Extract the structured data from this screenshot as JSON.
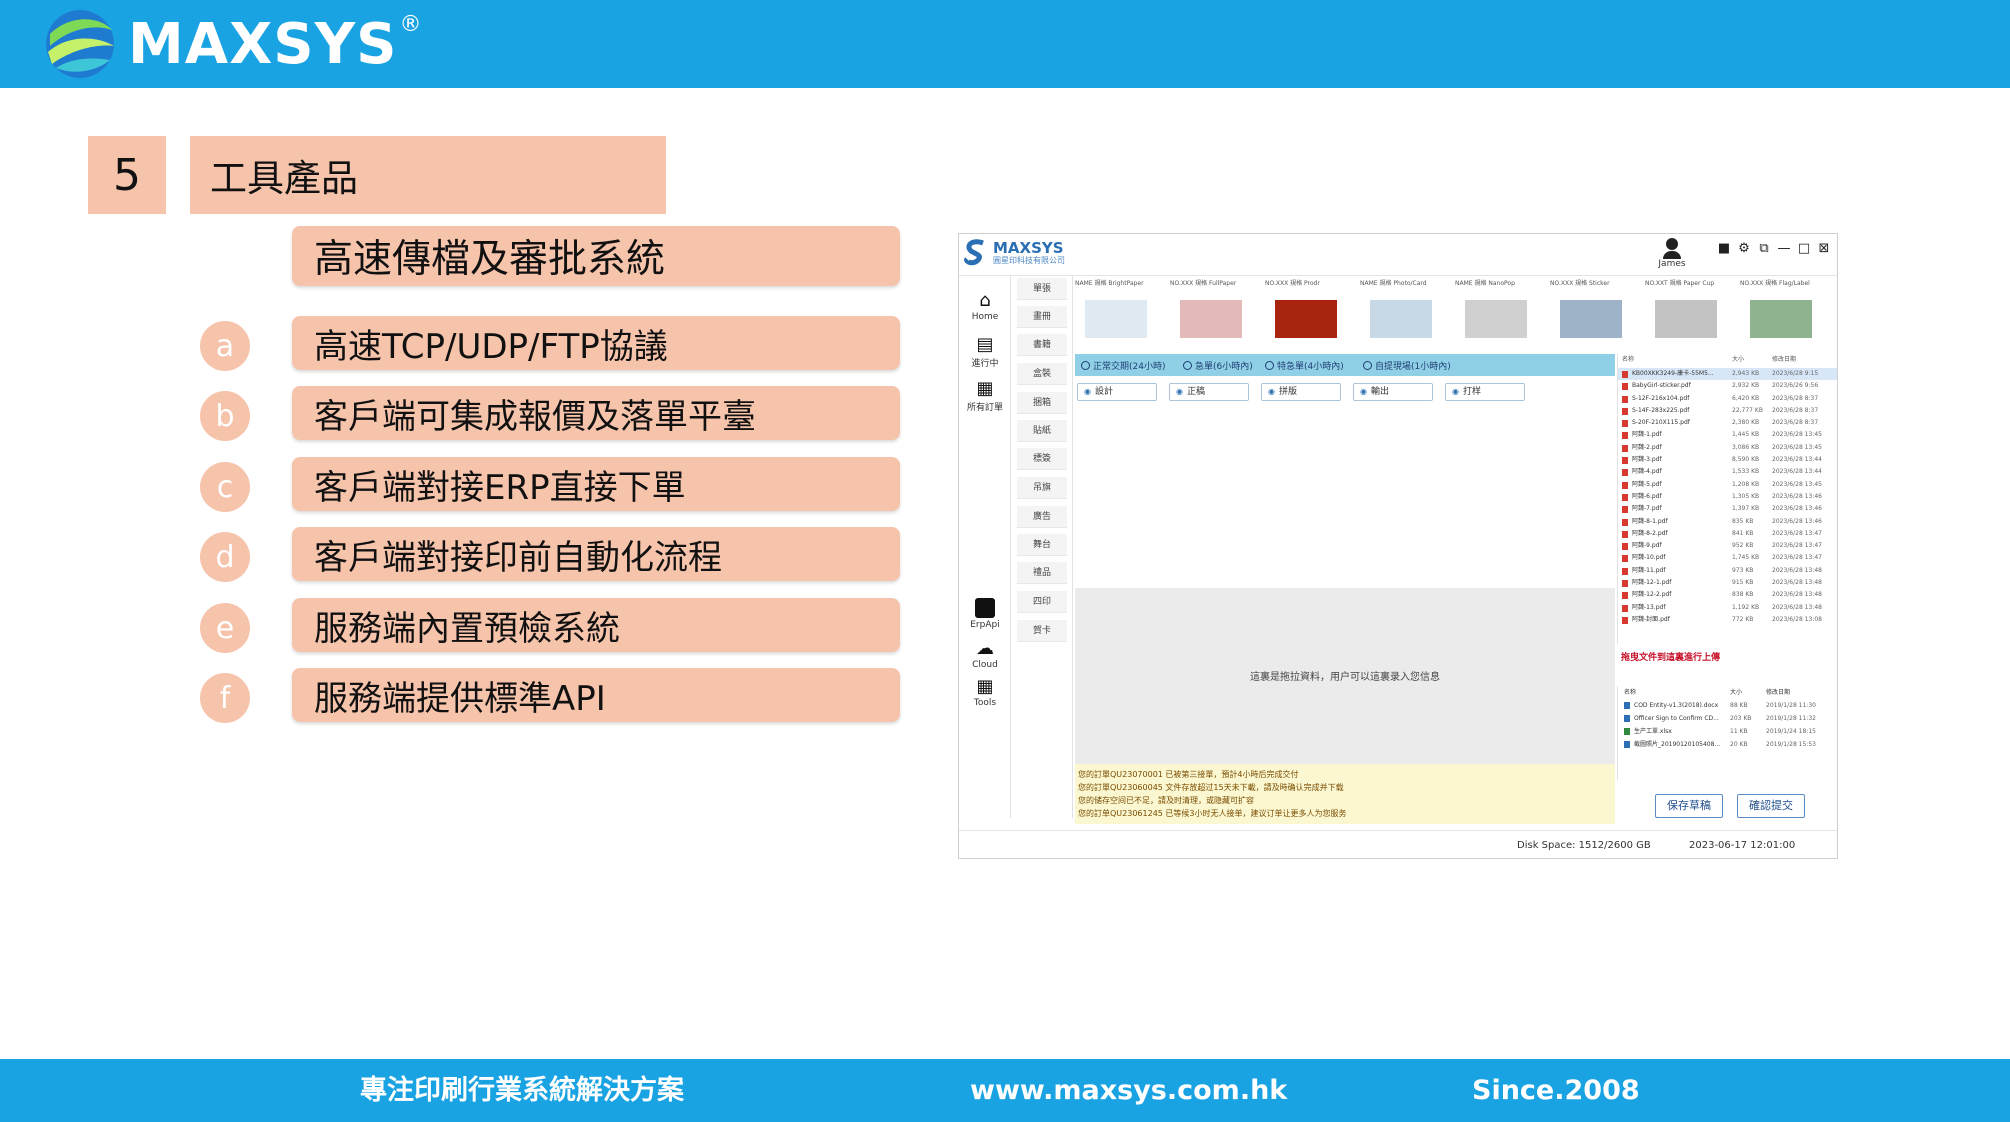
{
  "header": {
    "logo_text": "MAXSYS",
    "logo_reg": "®",
    "bg_color": "#1aa3e3"
  },
  "section": {
    "number": "5",
    "title": "工具產品"
  },
  "subtitle": "高速傳檔及審批系統",
  "features": [
    {
      "badge": "a",
      "label": "高速TCP/UDP/FTP協議"
    },
    {
      "badge": "b",
      "label": "客戶端可集成報價及落單平臺"
    },
    {
      "badge": "c",
      "label": "客戶端對接ERP直接下單"
    },
    {
      "badge": "d",
      "label": "客戶端對接印前自動化流程"
    },
    {
      "badge": "e",
      "label": "服務端內置預檢系統"
    },
    {
      "badge": "f",
      "label": "服務端提供標準API"
    }
  ],
  "app": {
    "logo": "MAXSYS",
    "company": "圓星印科技有限公司",
    "user": "James",
    "controls": [
      "■",
      "⚙",
      "⧉",
      "—",
      "□",
      "⊠"
    ],
    "sidebar": [
      {
        "icon": "home-icon",
        "label": "Home"
      },
      {
        "icon": "pdf-icon",
        "label": "進行中"
      },
      {
        "icon": "orders-icon",
        "label": "所有訂單"
      },
      {
        "icon": "erpapi-icon",
        "label": "ErpApi"
      },
      {
        "icon": "cloud-icon",
        "label": "Cloud"
      },
      {
        "icon": "tools-icon",
        "label": "Tools"
      }
    ],
    "categories": [
      "單張",
      "畫冊",
      "書籍",
      "盒裝",
      "捆箱",
      "貼紙",
      "標簽",
      "吊旗",
      "廣告",
      "舞台",
      "禮品",
      "四印",
      "賀卡"
    ],
    "thumbnails": [
      {
        "cap": "NAME      規格 BrightPaper",
        "color": "#dfe9f2"
      },
      {
        "cap": "NO.XXX      規格 FullPaper",
        "color": "#e4b9b9"
      },
      {
        "cap": "NO.XXX      規格 Prodr",
        "color": "#a8240f"
      },
      {
        "cap": "NAME      規格 Photo/Card",
        "color": "#c7d8e6"
      },
      {
        "cap": "NAME      規格 NanoPop",
        "color": "#d0d0d0"
      },
      {
        "cap": "NO.XXX      規格 Sticker",
        "color": "#9eb3c8"
      },
      {
        "cap": "NO.XXT      規格 Paper Cup",
        "color": "#c3c3c3"
      },
      {
        "cap": "NO.XXX      規格 Flag/Label",
        "color": "#8fb28f"
      }
    ],
    "delivery_options": [
      "正常交期(24小時)",
      "急單(6小時內)",
      "特急單(4小時內)",
      "自提現場(1小時內)"
    ],
    "steps": [
      "設計",
      "正稿",
      "拼版",
      "輸出",
      "打样"
    ],
    "drop_hint": "這裏是拖拉資料，用户可以這裏录入您信息",
    "log_lines": [
      "您的訂單QU23070001 已被第三接單，預計4小時后完成交付",
      "您的訂單QU23060045 文件存放超过15天未下載，請及時确认完成并下载",
      "您的储存空间已不足，請及时清理，或隐藏可扩容",
      "您的訂单QU23061245 已等候3小时无人接单，建议订单让更多人为您服务"
    ],
    "files_header": [
      "名称",
      "大小",
      "修改日期"
    ],
    "files": [
      {
        "name": "KB00XKK3249-康卡-55M5...",
        "size": "2,943 KB",
        "date": "2023/6/28 9:15",
        "sel": true
      },
      {
        "name": "BabyGirl-sticker.pdf",
        "size": "2,932 KB",
        "date": "2023/6/26 9:56"
      },
      {
        "name": "S-12F-216x104.pdf",
        "size": "6,420 KB",
        "date": "2023/6/28 8:37"
      },
      {
        "name": "S-14F-283x225.pdf",
        "size": "22,777 KB",
        "date": "2023/6/28 8:37"
      },
      {
        "name": "S-20F-210X115.pdf",
        "size": "2,380 KB",
        "date": "2023/6/28 8:37"
      },
      {
        "name": "阿魏-1.pdf",
        "size": "1,445 KB",
        "date": "2023/6/28 13:45"
      },
      {
        "name": "阿魏-2.pdf",
        "size": "3,086 KB",
        "date": "2023/6/28 13:45"
      },
      {
        "name": "阿魏-3.pdf",
        "size": "8,590 KB",
        "date": "2023/6/28 13:44"
      },
      {
        "name": "阿魏-4.pdf",
        "size": "1,533 KB",
        "date": "2023/6/28 13:44"
      },
      {
        "name": "阿魏-5.pdf",
        "size": "1,208 KB",
        "date": "2023/6/28 13:45"
      },
      {
        "name": "阿魏-6.pdf",
        "size": "1,305 KB",
        "date": "2023/6/28 13:46"
      },
      {
        "name": "阿魏-7.pdf",
        "size": "1,397 KB",
        "date": "2023/6/28 13:46"
      },
      {
        "name": "阿魏-8-1.pdf",
        "size": "835 KB",
        "date": "2023/6/28 13:46"
      },
      {
        "name": "阿魏-8-2.pdf",
        "size": "841 KB",
        "date": "2023/6/28 13:47"
      },
      {
        "name": "阿魏-9.pdf",
        "size": "952 KB",
        "date": "2023/6/28 13:47"
      },
      {
        "name": "阿魏-10.pdf",
        "size": "1,745 KB",
        "date": "2023/6/28 13:47"
      },
      {
        "name": "阿魏-11.pdf",
        "size": "973 KB",
        "date": "2023/6/28 13:48"
      },
      {
        "name": "阿魏-12-1.pdf",
        "size": "915 KB",
        "date": "2023/6/28 13:48"
      },
      {
        "name": "阿魏-12-2.pdf",
        "size": "838 KB",
        "date": "2023/6/28 13:48"
      },
      {
        "name": "阿魏-13.pdf",
        "size": "1,192 KB",
        "date": "2023/6/28 13:48"
      },
      {
        "name": "阿魏-封面.pdf",
        "size": "772 KB",
        "date": "2023/6/28 13:08"
      }
    ],
    "drop_docs_hint": "拖曳文件到這裏進行上傳",
    "docs_header": [
      "名称",
      "大小",
      "修改日期"
    ],
    "docs": [
      {
        "name": "COD Entity-v1.3(2018).docx",
        "size": "88 KB",
        "date": "2019/1/28 11:30",
        "color": "#2a6fb3"
      },
      {
        "name": "Officer Sign to Confirm CD...",
        "size": "203 KB",
        "date": "2019/1/28 11:32",
        "color": "#2a6fb3"
      },
      {
        "name": "生产工單.xlsx",
        "size": "11 KB",
        "date": "2019/1/24 18:15",
        "color": "#2f8a3f"
      },
      {
        "name": "截圖照片_20190120105408...",
        "size": "20 KB",
        "date": "2019/1/28 15:53",
        "color": "#2a6fb3"
      }
    ],
    "save_button": "保存草稿",
    "confirm_button": "確認提交",
    "disk_space": "Disk Space: 1512/2600 GB",
    "timestamp": "2023-06-17 12:01:00"
  },
  "footer": {
    "slogan": "專注印刷行業系統解決方案",
    "website": "www.maxsys.com.hk",
    "since": "Since.2008"
  },
  "colors": {
    "brand_blue": "#1aa3e3",
    "peach": "#f6c3ab"
  }
}
